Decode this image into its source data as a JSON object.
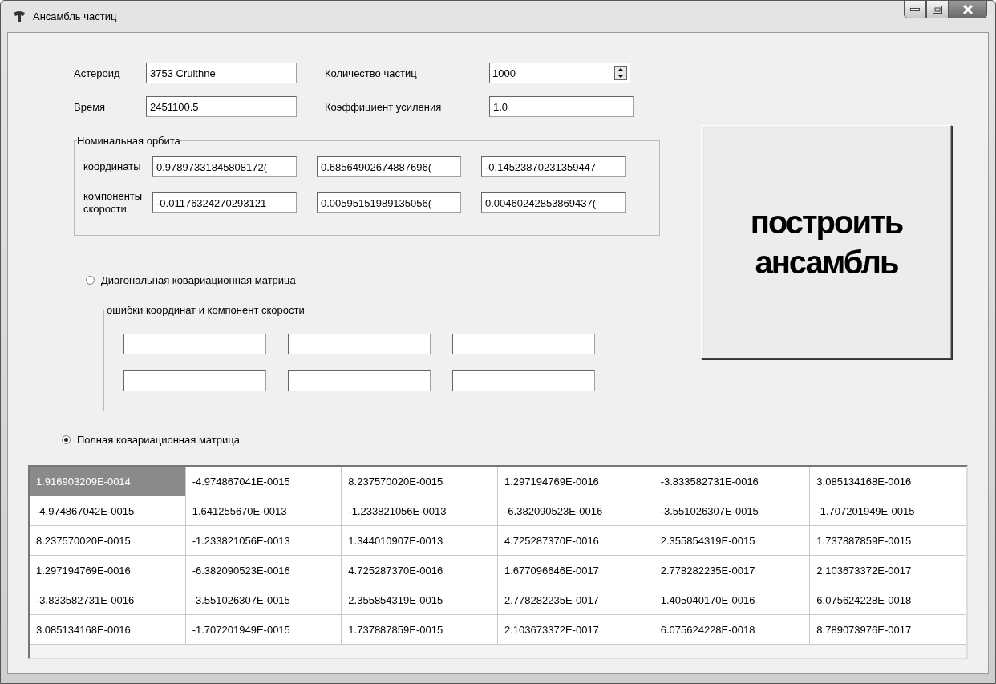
{
  "window": {
    "title": "Ансамбль частиц"
  },
  "params": [
    {
      "label": "Астероид",
      "value": "3753 Cruithne",
      "kind": "text"
    },
    {
      "label": "Количество частиц",
      "value": "1000",
      "kind": "spinner"
    },
    {
      "label": "Время",
      "value": "2451100.5",
      "kind": "text"
    },
    {
      "label": "Коэффициент усиления",
      "value": "1.0",
      "kind": "text"
    }
  ],
  "nominal_orbit": {
    "title": "Номинальная орбита",
    "rows": [
      {
        "label": "координаты",
        "values": [
          "0.97897331845808172(",
          "0.68564902674887696(",
          "-0.14523870231359447"
        ]
      },
      {
        "label": "компоненты скорости",
        "values": [
          "-0.01176324270293121",
          "0.00595151989135056(",
          "0.00460242853869437("
        ]
      }
    ]
  },
  "diagonal": {
    "label": "Диагональная ковариационная матрица",
    "selected": false,
    "group_title": "ошибки координат и компонент скорости"
  },
  "full": {
    "label": "Полная ковариационная матрица",
    "selected": true
  },
  "build_button": {
    "label": "построить ансамбль"
  },
  "matrix": {
    "rows": [
      [
        {
          "text": "1.916903209E-0014",
          "selected": true
        },
        {
          "text": "-4.974867041E-0015",
          "selected": false
        },
        {
          "text": "8.237570020E-0015",
          "selected": false
        },
        {
          "text": "1.297194769E-0016",
          "selected": false
        },
        {
          "text": "-3.833582731E-0016",
          "selected": false
        },
        {
          "text": "3.085134168E-0016",
          "selected": false
        }
      ],
      [
        {
          "text": "-4.974867042E-0015",
          "selected": false
        },
        {
          "text": "1.641255670E-0013",
          "selected": false
        },
        {
          "text": "-1.233821056E-0013",
          "selected": false
        },
        {
          "text": "-6.382090523E-0016",
          "selected": false
        },
        {
          "text": "-3.551026307E-0015",
          "selected": false
        },
        {
          "text": "-1.707201949E-0015",
          "selected": false
        }
      ],
      [
        {
          "text": "8.237570020E-0015",
          "selected": false
        },
        {
          "text": "-1.233821056E-0013",
          "selected": false
        },
        {
          "text": "1.344010907E-0013",
          "selected": false
        },
        {
          "text": "4.725287370E-0016",
          "selected": false
        },
        {
          "text": "2.355854319E-0015",
          "selected": false
        },
        {
          "text": "1.737887859E-0015",
          "selected": false
        }
      ],
      [
        {
          "text": "1.297194769E-0016",
          "selected": false
        },
        {
          "text": "-6.382090523E-0016",
          "selected": false
        },
        {
          "text": "4.725287370E-0016",
          "selected": false
        },
        {
          "text": "1.677096646E-0017",
          "selected": false
        },
        {
          "text": "2.778282235E-0017",
          "selected": false
        },
        {
          "text": "2.103673372E-0017",
          "selected": false
        }
      ],
      [
        {
          "text": "-3.833582731E-0016",
          "selected": false
        },
        {
          "text": "-3.551026307E-0015",
          "selected": false
        },
        {
          "text": "2.355854319E-0015",
          "selected": false
        },
        {
          "text": "2.778282235E-0017",
          "selected": false
        },
        {
          "text": "1.405040170E-0016",
          "selected": false
        },
        {
          "text": "6.075624228E-0018",
          "selected": false
        }
      ],
      [
        {
          "text": "3.085134168E-0016",
          "selected": false
        },
        {
          "text": "-1.707201949E-0015",
          "selected": false
        },
        {
          "text": "1.737887859E-0015",
          "selected": false
        },
        {
          "text": "2.103673372E-0017",
          "selected": false
        },
        {
          "text": "6.075624228E-0018",
          "selected": false
        },
        {
          "text": "8.789073976E-0017",
          "selected": false
        }
      ]
    ]
  }
}
